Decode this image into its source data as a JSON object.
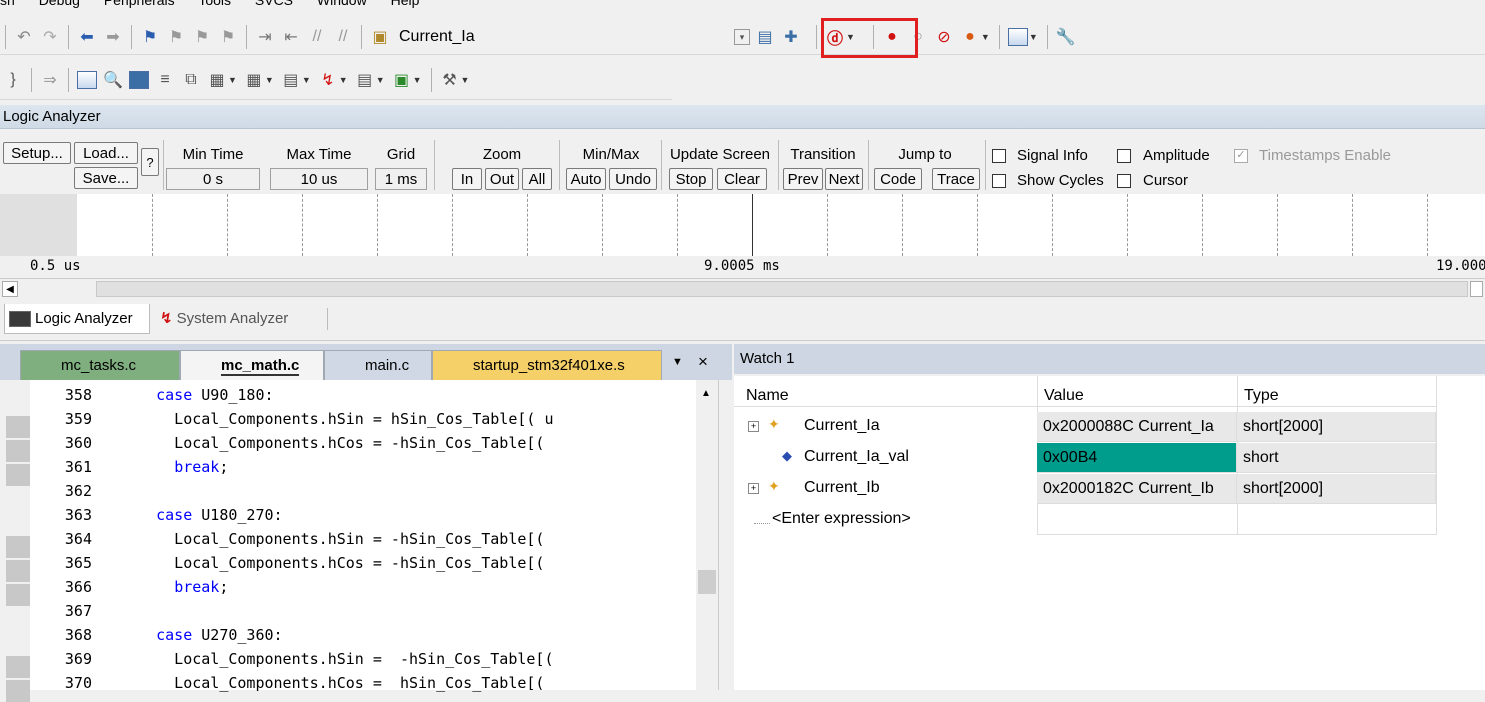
{
  "menu": [
    "sh",
    "Debug",
    "Peripherals",
    "Tools",
    "SVCS",
    "Window",
    "Help"
  ],
  "toolbar1": {
    "target_label": "Current_Ia"
  },
  "logic_analyzer": {
    "title": "Logic Analyzer",
    "buttons": {
      "setup": "Setup...",
      "load": "Load...",
      "save": "Save...",
      "help": "?",
      "zoom_in": "In",
      "zoom_out": "Out",
      "zoom_all": "All",
      "auto": "Auto",
      "undo": "Undo",
      "stop": "Stop",
      "clear": "Clear",
      "prev": "Prev",
      "next": "Next",
      "code": "Code",
      "trace": "Trace"
    },
    "labels": {
      "min_time": "Min Time",
      "max_time": "Max Time",
      "grid": "Grid",
      "zoom": "Zoom",
      "minmax": "Min/Max",
      "update_screen": "Update Screen",
      "transition": "Transition",
      "jump_to": "Jump to"
    },
    "values": {
      "min_time": "0 s",
      "max_time": "10 us",
      "grid": "1 ms"
    },
    "options": {
      "signal_info": "Signal Info",
      "amplitude": "Amplitude",
      "timestamps": "Timestamps Enable",
      "show_cycles": "Show Cycles",
      "cursor": "Cursor"
    },
    "axis": {
      "left": "0.5 us",
      "mid": "9.0005 ms",
      "right": "19.000"
    }
  },
  "bottom_tabs": {
    "logic": "Logic Analyzer",
    "system": "System Analyzer"
  },
  "editor_tabs": [
    "mc_tasks.c",
    "mc_math.c",
    "main.c",
    "startup_stm32f401xe.s"
  ],
  "editor_tab_close": "×",
  "code_lines": [
    {
      "n": "358",
      "text": "    case U90_180:"
    },
    {
      "n": "359",
      "text": "      Local_Components.hSin = hSin_Cos_Table[( u"
    },
    {
      "n": "360",
      "text": "      Local_Components.hCos = -hSin_Cos_Table[("
    },
    {
      "n": "361",
      "text": "      break;"
    },
    {
      "n": "362",
      "text": ""
    },
    {
      "n": "363",
      "text": "    case U180_270:"
    },
    {
      "n": "364",
      "text": "      Local_Components.hSin = -hSin_Cos_Table[("
    },
    {
      "n": "365",
      "text": "      Local_Components.hCos = -hSin_Cos_Table[("
    },
    {
      "n": "366",
      "text": "      break;"
    },
    {
      "n": "367",
      "text": ""
    },
    {
      "n": "368",
      "text": "    case U270_360:"
    },
    {
      "n": "369",
      "text": "      Local_Components.hSin =  -hSin_Cos_Table[("
    },
    {
      "n": "370",
      "text": "      Local_Components.hCos =  hSin_Cos_Table[("
    }
  ],
  "watch": {
    "title": "Watch 1",
    "headers": {
      "name": "Name",
      "value": "Value",
      "type": "Type"
    },
    "rows": [
      {
        "name": "Current_Ia",
        "value": "0x2000088C Current_Ia",
        "type": "short[2000]"
      },
      {
        "name": "Current_Ia_val",
        "value": "0x00B4",
        "type": "short"
      },
      {
        "name": "Current_Ib",
        "value": "0x2000182C Current_Ib",
        "type": "short[2000]"
      },
      {
        "name": "<Enter expression>",
        "value": "",
        "type": ""
      }
    ],
    "highlight_color": "#009c8c"
  }
}
